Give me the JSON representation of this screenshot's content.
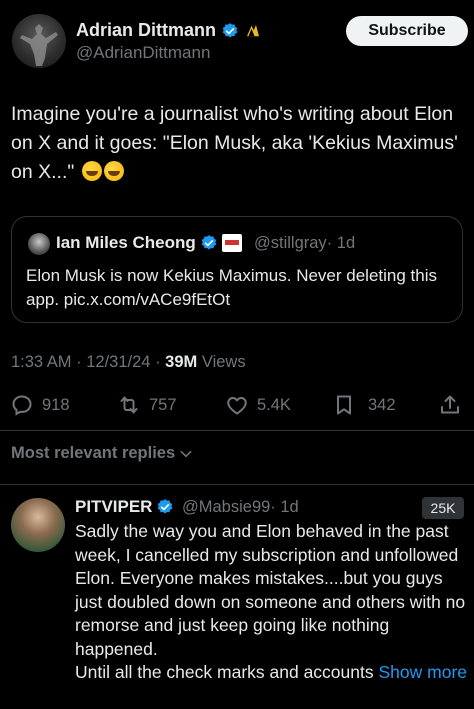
{
  "tweet": {
    "author_name": "Adrian Dittmann",
    "author_handle": "@AdrianDittmann",
    "subscribe_label": "Subscribe",
    "text": "Imagine you're a journalist who's writing about Elon on X and it goes: \"Elon Musk, aka 'Kekius Maximus' on X...\"",
    "emoji": "rolling-on-floor-laughing",
    "quote": {
      "author_name": "Ian Miles Cheong",
      "author_handle": "@stillgray",
      "time": "· 1d",
      "text": "Elon Musk is now Kekius Maximus. Never deleting this app. pic.x.com/vACe9fEtOt"
    },
    "time": "1:33 AM",
    "date": "12/31/24",
    "views_count": "39M",
    "views_label": "Views",
    "sep": "·"
  },
  "actions": {
    "replies": "918",
    "reposts": "757",
    "likes": "5.4K",
    "bookmarks": "342"
  },
  "sort_label": "Most relevant replies",
  "reply": {
    "author_name": "PITVIPER",
    "author_handle": "@Mabsie99",
    "time": "· 1d",
    "badge": "25K",
    "text": "Sadly the way you and Elon behaved in the past week, I cancelled my subscription and unfollowed Elon. Everyone makes mistakes....but you guys just doubled down on someone and others with no remorse and just keep going like nothing happened.",
    "text_2": "Until all the check marks and accounts",
    "show_more": "Show more"
  },
  "colors": {
    "background": "#000000",
    "text_primary": "#e7e9ea",
    "text_secondary": "#71767b",
    "verified_blue": "#1d9bf0",
    "link": "#1d9bf0",
    "border": "#2f3336"
  }
}
